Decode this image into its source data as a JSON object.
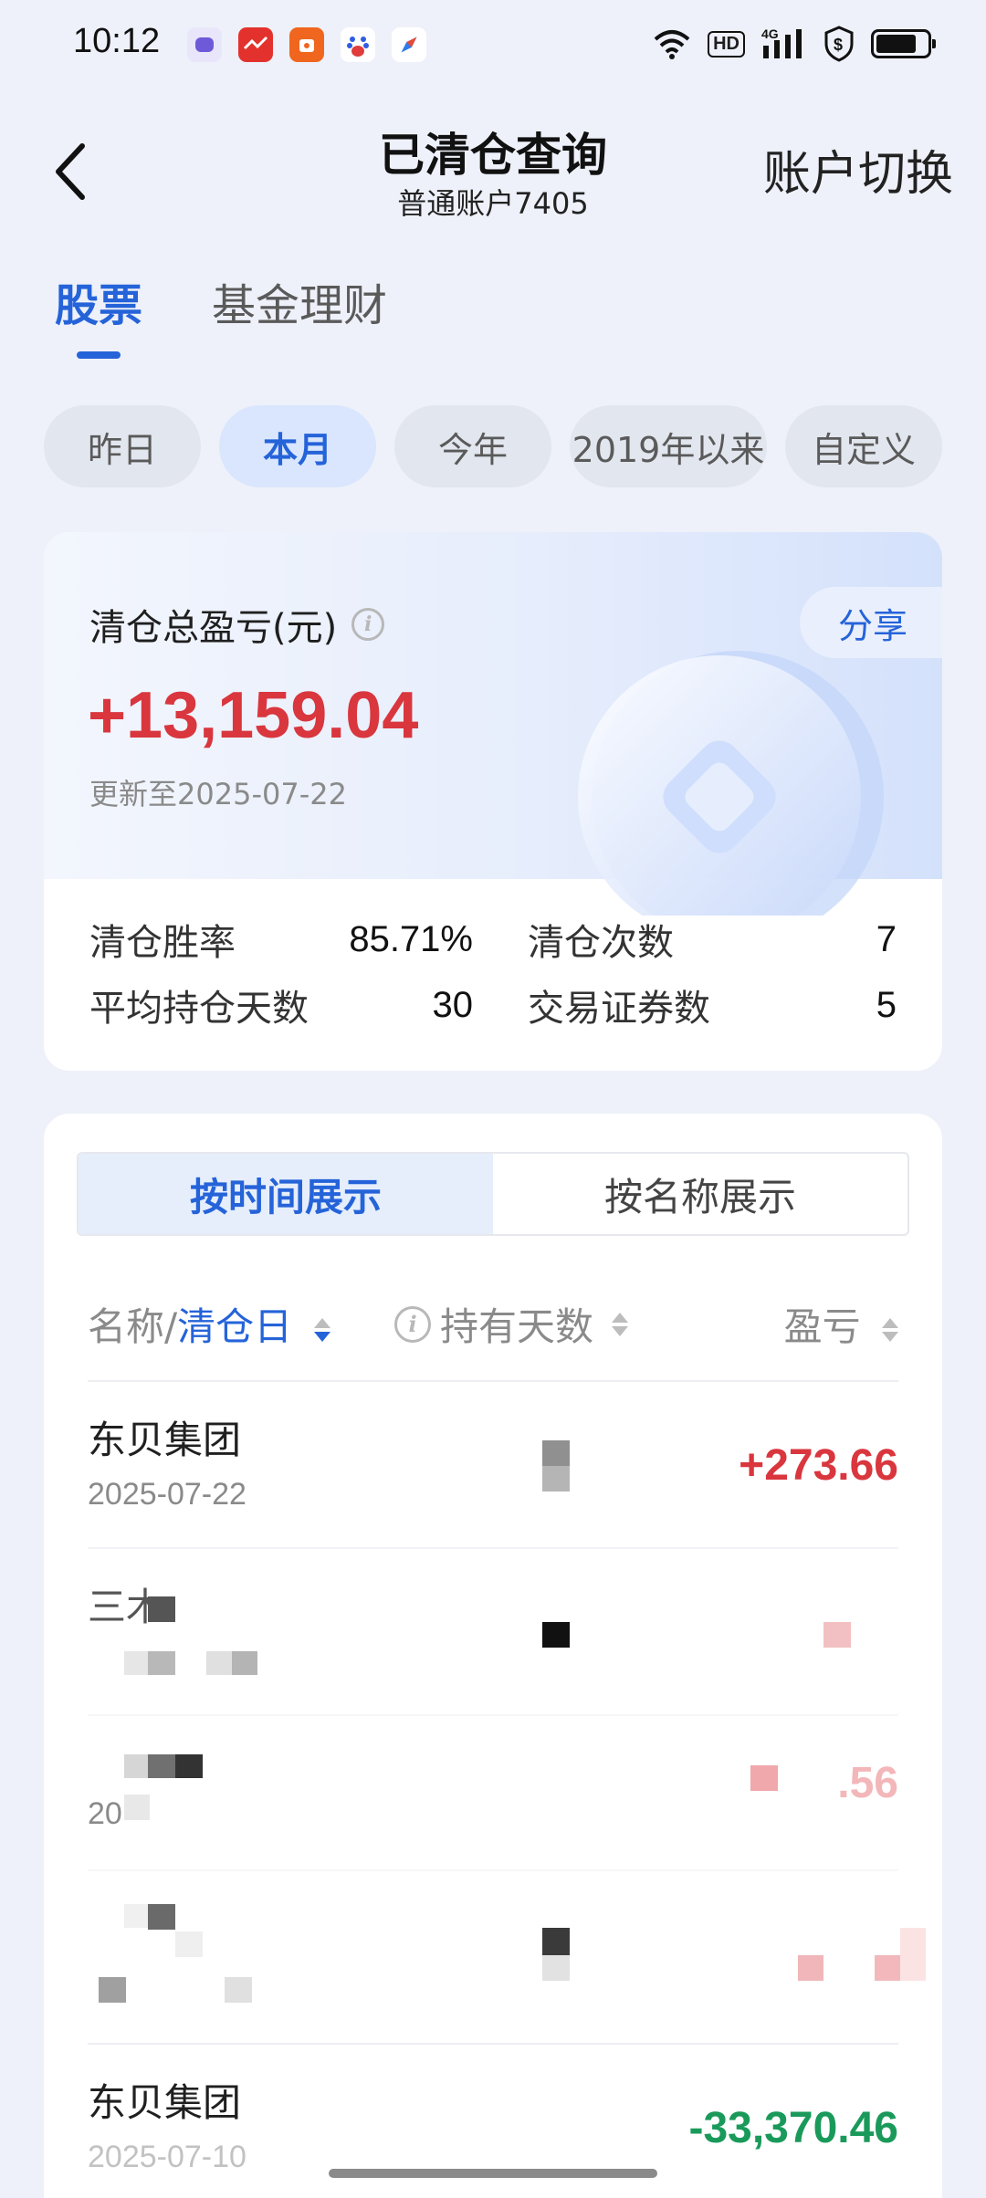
{
  "status_bar": {
    "time": "10:12",
    "network_label": "4G",
    "hd_label": "HD",
    "battery_percent": 80,
    "app_icons": [
      {
        "name": "messages-app-icon",
        "color": "#6e5ad8"
      },
      {
        "name": "news-app-icon",
        "color": "#e3322d"
      },
      {
        "name": "shopping-app-icon",
        "color": "#f0661e"
      },
      {
        "name": "baidu-app-icon",
        "color": "#ffffff"
      },
      {
        "name": "compass-app-icon",
        "color": "#2f7bea"
      }
    ]
  },
  "header": {
    "title": "已清仓查询",
    "subtitle": "普通账户7405",
    "account_switch": "账户切换"
  },
  "main_tabs": [
    {
      "label": "股票",
      "active": true
    },
    {
      "label": "基金理财",
      "active": false
    }
  ],
  "period_chips": [
    {
      "label": "昨日",
      "active": false
    },
    {
      "label": "本月",
      "active": true
    },
    {
      "label": "今年",
      "active": false
    },
    {
      "label": "2019年以来",
      "active": false
    },
    {
      "label": "自定义",
      "active": false
    }
  ],
  "summary": {
    "label": "清仓总盈亏(元)",
    "share": "分享",
    "total": "+13,159.04",
    "updated": "更新至2025-07-22",
    "stats": {
      "win_rate_label": "清仓胜率",
      "win_rate": "85.71%",
      "count_label": "清仓次数",
      "count": "7",
      "avg_days_label": "平均持仓天数",
      "avg_days": "30",
      "securities_label": "交易证券数",
      "securities": "5"
    }
  },
  "list": {
    "segments": [
      {
        "label": "按时间展示",
        "active": true
      },
      {
        "label": "按名称展示",
        "active": false
      }
    ],
    "columns": {
      "name_prefix": "名称/",
      "name_sort": "清仓日",
      "days": "持有天数",
      "pnl": "盈亏"
    },
    "rows": [
      {
        "name": "东贝集团",
        "date": "2025-07-22",
        "pnl": "+273.66",
        "trend": "pos"
      },
      {
        "name": "三木",
        "date": "",
        "pnl": "",
        "trend": "pos"
      },
      {
        "name": "",
        "date": "20",
        "pnl": ".56",
        "trend": "pos"
      },
      {
        "name": "",
        "date": "",
        "pnl": "",
        "trend": "pos"
      },
      {
        "name": "东贝集团",
        "date": "2025-07-10",
        "pnl": "-33,370.46",
        "trend": "neg"
      }
    ]
  },
  "colors": {
    "accent": "#2563d9",
    "gain": "#d9363e",
    "loss": "#1a9a5a"
  }
}
